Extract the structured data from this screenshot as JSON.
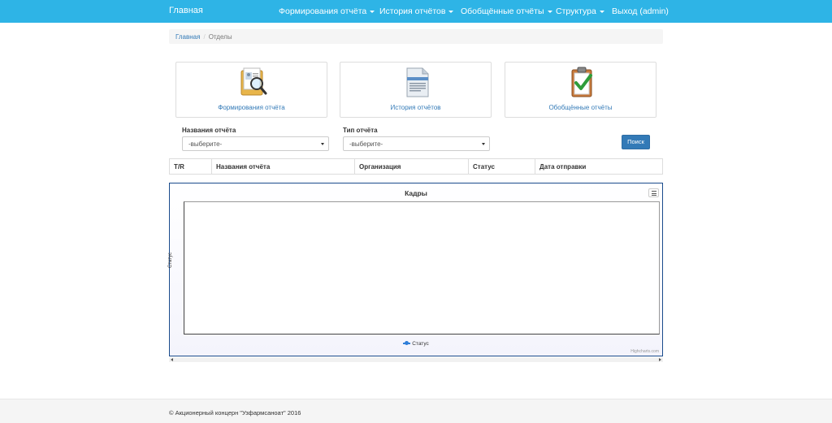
{
  "navbar": {
    "brand": "Главная",
    "items": [
      {
        "label": "Формирования отчёта",
        "dropdown": true
      },
      {
        "label": "История отчётов",
        "dropdown": true
      },
      {
        "label": "Обобщённые отчёты",
        "dropdown": true
      },
      {
        "label": "Структура",
        "dropdown": true
      },
      {
        "label": "Выход (admin)",
        "dropdown": false
      }
    ]
  },
  "breadcrumb": {
    "home": "Главная",
    "current": "Отделы"
  },
  "cards": [
    {
      "label": "Формирования отчёта",
      "icon": "folder-magnifier-icon"
    },
    {
      "label": "История отчётов",
      "icon": "document-icon"
    },
    {
      "label": "Обобщённые отчёты",
      "icon": "clipboard-check-icon"
    }
  ],
  "filters": {
    "report_name_label": "Названия отчёта",
    "report_name_value": "-выберите-",
    "report_type_label": "Тип отчёта",
    "report_type_value": "-выберите-",
    "search_button": "Поиск"
  },
  "table": {
    "columns": [
      "T/R",
      "Названия отчёта",
      "Организация",
      "Статус",
      "Дата отправки"
    ]
  },
  "chart": {
    "title": "Кадры",
    "ylabel": "Статус",
    "legend": "Статус",
    "credit": "Highcharts.com",
    "series_color": "#2f7ed8"
  },
  "chart_data": {
    "type": "line",
    "title": "Кадры",
    "ylabel": "Статус",
    "xlabel": "",
    "series": [
      {
        "name": "Статус",
        "values": []
      }
    ],
    "grid": false,
    "legend": "bottom-center"
  },
  "footer": {
    "text": "© Акционерный концерн \"Узфармсаноат\" 2016"
  },
  "colors": {
    "navbar": "#2eb4e6",
    "link": "#337ab7",
    "button": "#337ab7"
  }
}
